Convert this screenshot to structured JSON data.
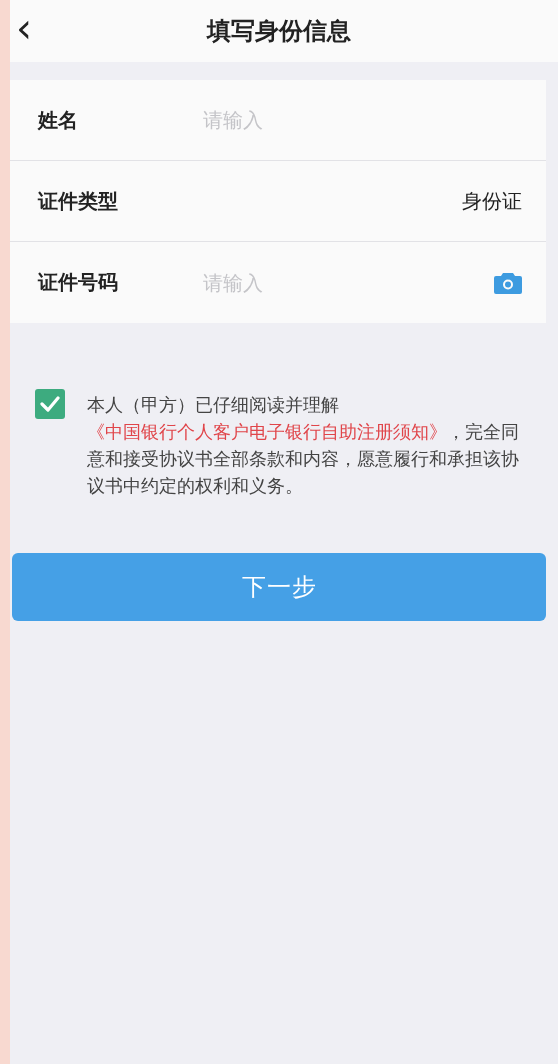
{
  "header": {
    "back_icon": "‹",
    "title": "填写身份信息"
  },
  "form": {
    "rows": [
      {
        "kind": "input",
        "label": "姓名",
        "placeholder": "请输入"
      },
      {
        "kind": "select",
        "label": "证件类型",
        "value": "身份证"
      },
      {
        "kind": "input_camera",
        "label": "证件号码",
        "placeholder": "请输入"
      }
    ]
  },
  "agreement": {
    "checked": true,
    "text_before": "本人（甲方）已仔细阅读并理解",
    "link": "《中国银行个人客户电子银行自助注册须知》",
    "text_after": "，完全同意和接受协议书全部条款和内容，愿意履行和承担该协议书中约定的权利和义务。"
  },
  "next_button": {
    "label": "下一步"
  }
}
